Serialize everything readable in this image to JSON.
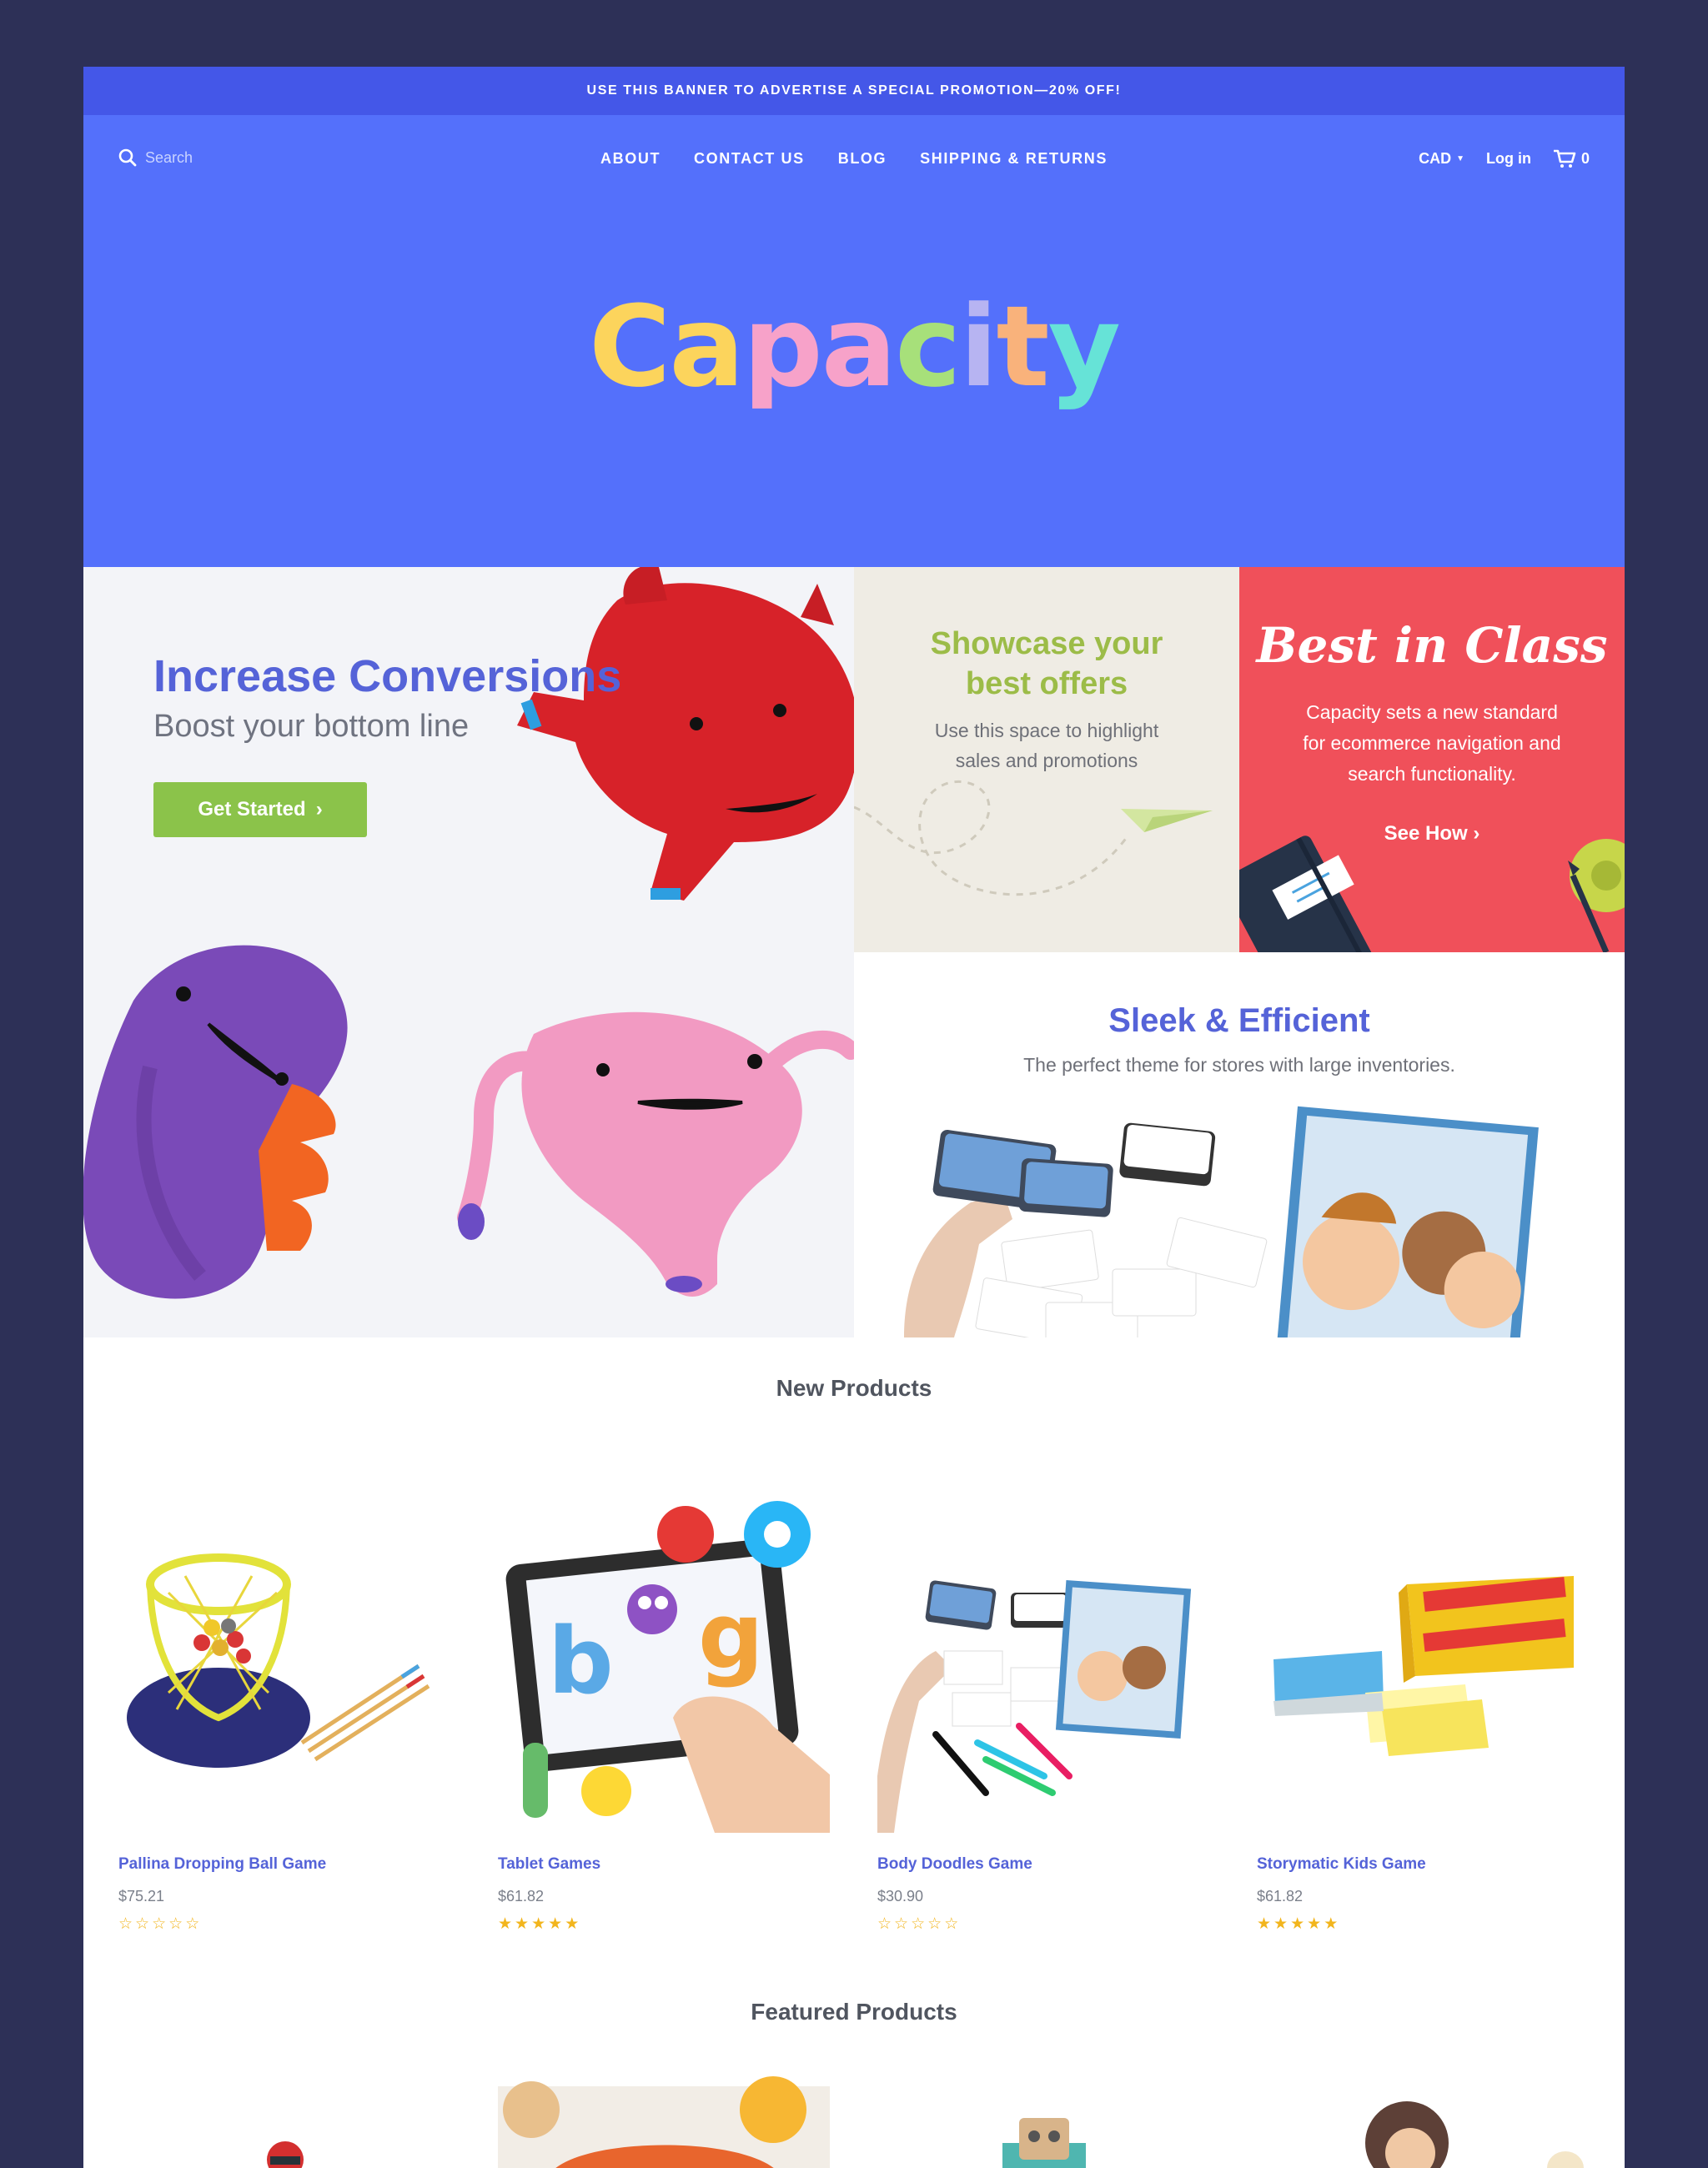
{
  "promo_banner": {
    "text": "USE THIS BANNER TO ADVERTISE A SPECIAL PROMOTION—20% OFF!"
  },
  "header": {
    "search_placeholder": "Search",
    "nav": [
      "ABOUT",
      "CONTACT US",
      "BLOG",
      "SHIPPING & RETURNS"
    ],
    "currency": "CAD",
    "login": "Log in",
    "cart_count": "0",
    "logo_letters": [
      "C",
      "a",
      "p",
      "a",
      "c",
      "i",
      "t",
      "y"
    ],
    "logo_colors": [
      "#fcd45c",
      "#fcd45c",
      "#f7a2c9",
      "#f7a2c9",
      "#a7e07a",
      "#b7b4f2",
      "#f9b27b",
      "#66e3d7"
    ]
  },
  "hero": {
    "title": "Increase Conversions",
    "subtitle": "Boost your bottom line",
    "button_label": "Get Started",
    "button_arrow": "›"
  },
  "tile_offers": {
    "title_line1": "Showcase your",
    "title_line2": "best offers",
    "text_line1": "Use this space to highlight",
    "text_line2": "sales and promotions"
  },
  "tile_best": {
    "title": "Best in Class",
    "text_line1": "Capacity sets a new standard",
    "text_line2": "for ecommerce navigation and",
    "text_line3": "search functionality.",
    "link_label": "See How",
    "link_arrow": "›"
  },
  "tile_sleek": {
    "title": "Sleek & Efficient",
    "text": "The perfect theme for stores with large inventories."
  },
  "new_products": {
    "title": "New Products",
    "items": [
      {
        "name": "Pallina Dropping Ball Game",
        "price": "$75.21",
        "rating": 0
      },
      {
        "name": "Tablet Games",
        "price": "$61.82",
        "rating": 5
      },
      {
        "name": "Body Doodles Game",
        "price": "$30.90",
        "rating": 0
      },
      {
        "name": "Storymatic Kids Game",
        "price": "$61.82",
        "rating": 5
      }
    ]
  },
  "featured_products": {
    "title": "Featured Products"
  },
  "colors": {
    "page_bg": "#2d3057",
    "banner": "#4457e8",
    "header": "#5470fb",
    "accent": "#5563d8",
    "green": "#8bc34a",
    "red_tile": "#f0505a",
    "beige_tile": "#efece4",
    "star": "#f2b51d"
  }
}
